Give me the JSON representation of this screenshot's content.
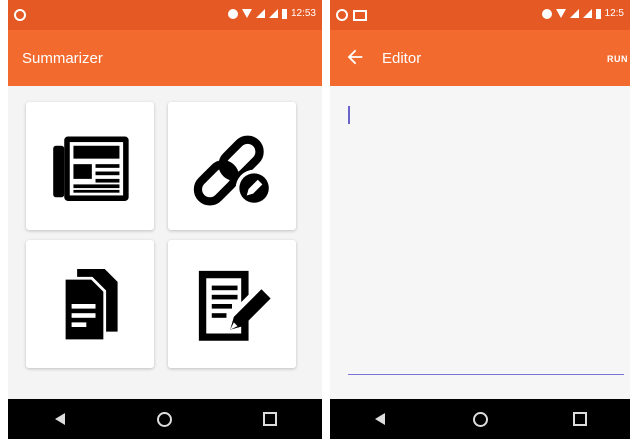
{
  "colors": {
    "status_bar": "#e55a24",
    "app_bar": "#f26a2e",
    "nav_bar": "#000000",
    "editor_line": "#7b74d6"
  },
  "left_screen": {
    "status_bar": {
      "time": "12:53"
    },
    "app_bar": {
      "title": "Summarizer"
    },
    "cards": [
      {
        "icon": "newspaper-icon"
      },
      {
        "icon": "link-edit-icon"
      },
      {
        "icon": "documents-icon"
      },
      {
        "icon": "write-note-icon"
      }
    ]
  },
  "right_screen": {
    "status_bar": {
      "time": "12:5"
    },
    "app_bar": {
      "title": "Editor",
      "action": "RUN"
    },
    "editor": {
      "text": ""
    }
  }
}
